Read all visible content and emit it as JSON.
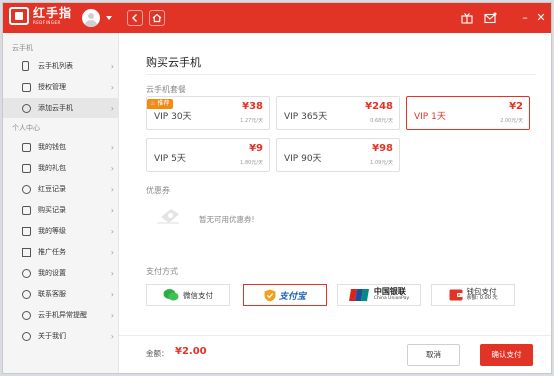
{
  "app": {
    "logo_name": "红手指",
    "logo_sub": "REDFINGER"
  },
  "sidebar": {
    "section1": "云手机",
    "section2": "个人中心",
    "items": [
      {
        "label": "云手机列表",
        "icon": "phone-icon"
      },
      {
        "label": "授权管理",
        "icon": "checkbox-icon"
      },
      {
        "label": "添加云手机",
        "icon": "add-circle-icon"
      },
      {
        "label": "我的钱包",
        "icon": "wallet-icon"
      },
      {
        "label": "我的礼包",
        "icon": "gift-icon"
      },
      {
        "label": "红豆记录",
        "icon": "bean-icon"
      },
      {
        "label": "购买记录",
        "icon": "receipt-icon"
      },
      {
        "label": "我的等级",
        "icon": "crown-icon"
      },
      {
        "label": "推广任务",
        "icon": "flag-icon"
      },
      {
        "label": "我的设置",
        "icon": "gear-icon"
      },
      {
        "label": "联系客服",
        "icon": "headset-icon"
      },
      {
        "label": "云手机异常提醒",
        "icon": "alert-icon"
      },
      {
        "label": "关于我们",
        "icon": "smile-icon"
      }
    ]
  },
  "main": {
    "title": "购买云手机",
    "plans_label": "云手机套餐",
    "hot_tag": "推荐",
    "plans": [
      {
        "name": "VIP 30天",
        "price": "¥38",
        "unit": "1.27元/天"
      },
      {
        "name": "VIP 365天",
        "price": "¥248",
        "unit": "0.68元/天"
      },
      {
        "name": "VIP 1天",
        "price": "¥2",
        "unit": "2.00元/天"
      },
      {
        "name": "VIP 5天",
        "price": "¥9",
        "unit": "1.80元/天"
      },
      {
        "name": "VIP 90天",
        "price": "¥98",
        "unit": "1.09元/天"
      }
    ],
    "coupon_label": "优惠券",
    "coupon_empty": "暂无可用优惠券!",
    "pay_label": "支付方式",
    "pay": {
      "wechat": "微信支付",
      "alipay": "支付宝",
      "unionpay_cn": "中国银联",
      "unionpay_en": "China UnionPay",
      "wallet": "钱包支付",
      "balance": "余额: 0.00 元"
    },
    "total_label": "金额：",
    "total_value": "¥2.00",
    "cancel": "取消",
    "confirm": "确认支付"
  },
  "colors": {
    "brand": "#e23426",
    "hot": "#f08b16"
  }
}
